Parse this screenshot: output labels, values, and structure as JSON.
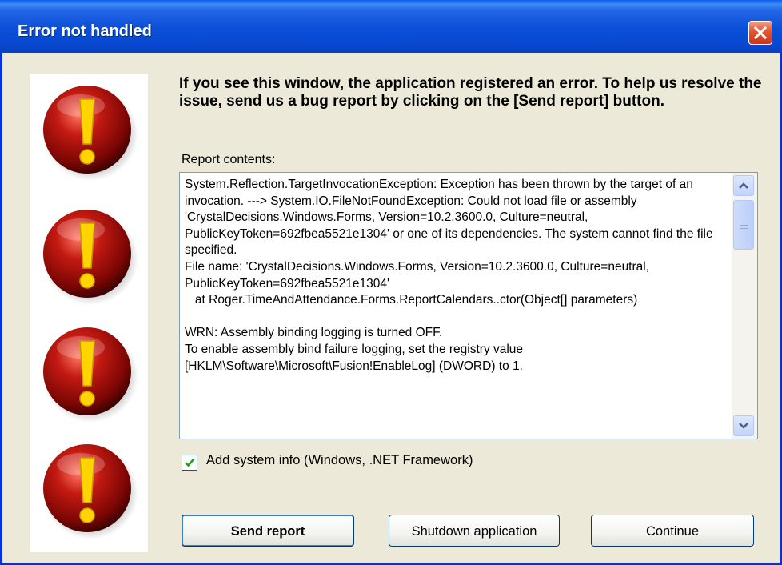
{
  "window": {
    "title": "Error not handled",
    "close_icon": "close-icon"
  },
  "icons": {
    "name": "warning-exclamation-icon",
    "count": 4,
    "color": "#c41a12"
  },
  "message": {
    "heading": "If you see this window, the application registered an error.  To help us resolve the issue, send us a bug report by clicking on the [Send report] button.",
    "report_label": "Report contents:",
    "report_text": "System.Reflection.TargetInvocationException: Exception has been thrown by the target of an invocation. ---> System.IO.FileNotFoundException: Could not load file or assembly 'CrystalDecisions.Windows.Forms, Version=10.2.3600.0, Culture=neutral, PublicKeyToken=692fbea5521e1304' or one of its dependencies. The system cannot find the file specified.\nFile name: 'CrystalDecisions.Windows.Forms, Version=10.2.3600.0, Culture=neutral, PublicKeyToken=692fbea5521e1304'\n   at Roger.TimeAndAttendance.Forms.ReportCalendars..ctor(Object[] parameters)\n\nWRN: Assembly binding logging is turned OFF.\nTo enable assembly bind failure logging, set the registry value [HKLM\\Software\\Microsoft\\Fusion!EnableLog] (DWORD) to 1."
  },
  "options": {
    "add_system_info_label": "Add system info (Windows, .NET Framework)",
    "add_system_info_checked": true
  },
  "buttons": {
    "send_report": "Send report",
    "shutdown": "Shutdown application",
    "continue": "Continue"
  }
}
